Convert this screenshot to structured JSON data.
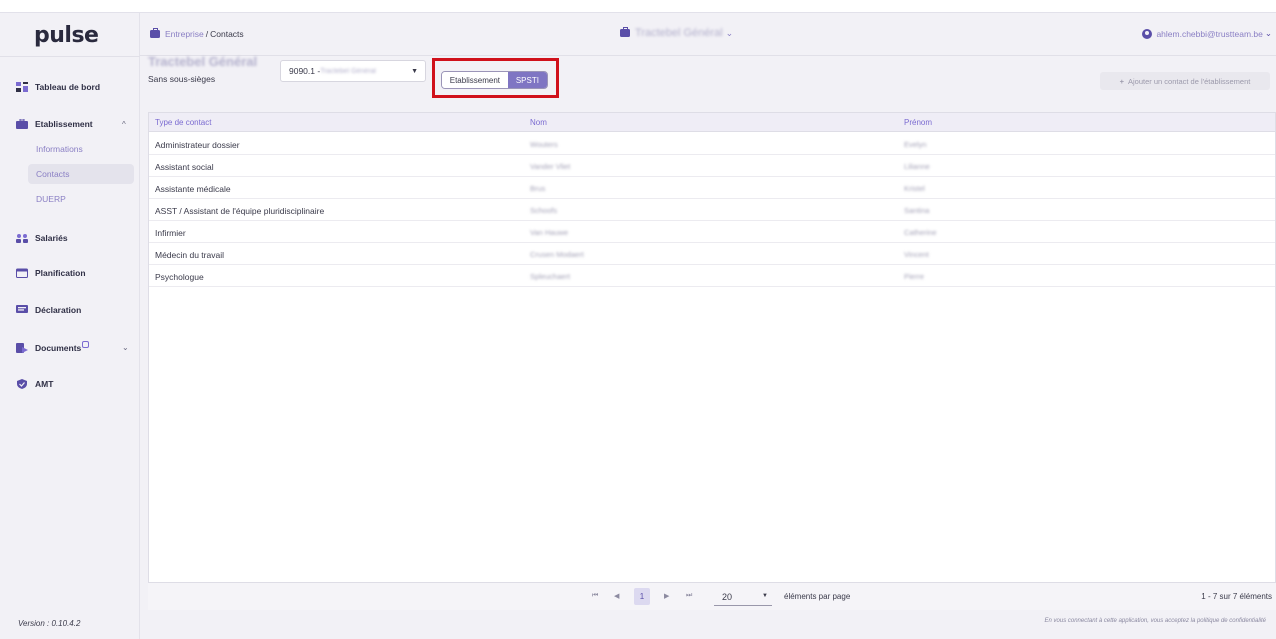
{
  "app": {
    "logo": "pulse",
    "version": "Version : 0.10.4.2"
  },
  "header": {
    "breadcrumb_link": "Entreprise",
    "breadcrumb_sep": "/",
    "breadcrumb_current": "Contacts",
    "company": "Tractebel Général",
    "company_chevron": "⌄",
    "user_email": "ahlem.chebbi@trustteam.be",
    "user_chevron": "⌄"
  },
  "sidebar": {
    "items": [
      {
        "label": "Tableau de bord",
        "icon": "dashboard-icon"
      },
      {
        "label": "Etablissement",
        "icon": "briefcase-icon"
      },
      {
        "label": "Salariés",
        "icon": "users-icon"
      },
      {
        "label": "Planification",
        "icon": "calendar-icon"
      },
      {
        "label": "Déclaration",
        "icon": "message-icon"
      },
      {
        "label": "Documents",
        "icon": "document-icon"
      },
      {
        "label": "AMT",
        "icon": "shield-icon"
      }
    ],
    "sub_items": [
      "Informations",
      "Contacts",
      "DUERP"
    ],
    "active_sub": "Contacts",
    "chevron_up": "^",
    "chevron_down": "⌄"
  },
  "toolbar": {
    "company_name": "Tractebel Général",
    "company_sub": "Sans sous-sièges",
    "select_code": "9090.1 - ",
    "select_name": "Tractebel Général",
    "select_caret": "▼",
    "toggle_off": "Etablissement",
    "toggle_on": "SPSTI",
    "add_label": "Ajouter un contact de l'établissement",
    "add_plus": "+"
  },
  "table": {
    "headers": [
      "Type de contact",
      "Nom",
      "Prénom"
    ],
    "rows": [
      [
        "Administrateur dossier",
        "Wouters",
        "Evelyn"
      ],
      [
        "Assistant social",
        "Vander Vliet",
        "Lilianne"
      ],
      [
        "Assistante médicale",
        "Brus",
        "Kristel"
      ],
      [
        "ASST / Assistant de l'équipe pluridisciplinaire",
        "Schoofs",
        "Santina"
      ],
      [
        "Infirmier",
        "Van Hauwe",
        "Catherine"
      ],
      [
        "Médecin du travail",
        "Crusen Modaert",
        "Vincent"
      ],
      [
        "Psychologue",
        "Spleuchaert",
        "Pierre"
      ]
    ]
  },
  "pagination": {
    "first": "⏮",
    "prev": "◀",
    "current": "1",
    "next": "▶",
    "last": "⏭",
    "page_size": "20",
    "page_size_caret": "▼",
    "per_page_label": "éléments par page",
    "count": "1 - 7 sur 7 éléments"
  },
  "footer": {
    "privacy": "En vous connectant à cette application, vous acceptez la politique de confidentialité"
  },
  "colors": {
    "accent": "#7f75c3",
    "highlight": "#d0111b",
    "link": "#8a7fc4"
  }
}
